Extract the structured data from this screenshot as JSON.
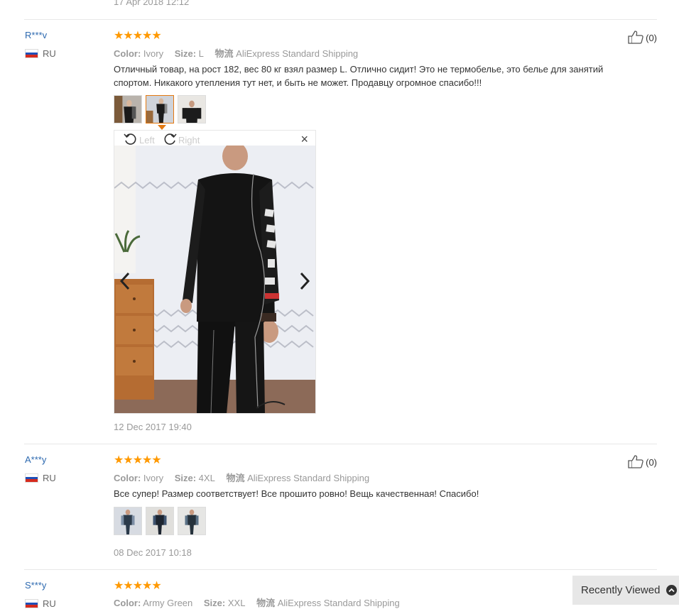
{
  "top_review_date": "17 Apr 2018 12:12",
  "labels": {
    "color": "Color:",
    "size": "Size:",
    "shipping": "物流",
    "rotate_left": "Left",
    "rotate_right": "Right",
    "close": "×"
  },
  "reviews": [
    {
      "user": "R***v",
      "country": "RU",
      "rating": 5,
      "color": "Ivory",
      "size": "L",
      "shipping": "AliExpress Standard Shipping",
      "text": "Отличный товар, на рост 182, вес 80 кг взял размер L. Отлично сидит! Это не термобелье, это белье для занятий спортом. Никакого утепления тут нет, и быть не может. Продавцу огромное спасибо!!!",
      "helpful": "(0)",
      "date": "12 Dec 2017 19:40"
    },
    {
      "user": "A***y",
      "country": "RU",
      "rating": 5,
      "color": "Ivory",
      "size": "4XL",
      "shipping": "AliExpress Standard Shipping",
      "text": "Все супер! Размер соответствует! Все прошито ровно! Вещь качественная! Спасибо!",
      "helpful": "(0)",
      "date": "08 Dec 2017 10:18"
    },
    {
      "user": "S***y",
      "country": "RU",
      "rating": 5,
      "color": "Army Green",
      "size": "XXL",
      "shipping": "AliExpress Standard Shipping"
    }
  ],
  "recently_viewed": "Recently Viewed",
  "colors": {
    "star": "#ff9900",
    "link": "#2e6ab0",
    "active_thumb": "#e47911"
  },
  "icons": [
    "thumbs-up-icon",
    "rotate-left-icon",
    "rotate-right-icon",
    "close-icon",
    "chevron-left-icon",
    "chevron-right-icon",
    "chevron-up-icon",
    "russia-flag-icon",
    "star-icon"
  ]
}
